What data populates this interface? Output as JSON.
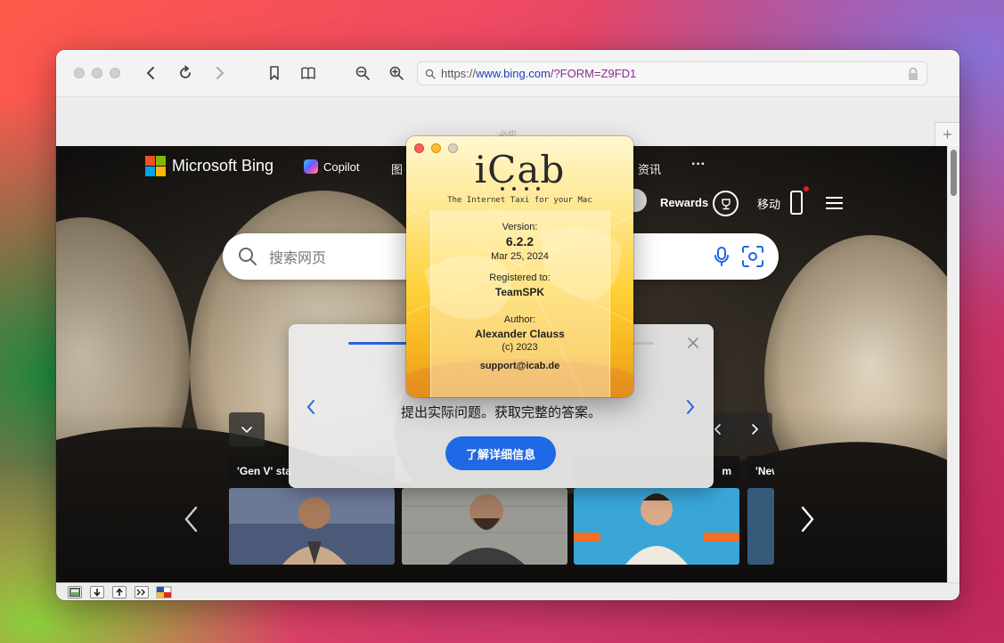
{
  "browser": {
    "url_scheme": "https://",
    "url_host": "www.bing.com",
    "url_path": "/?FORM=Z9FD1",
    "tab_hint": "必应",
    "new_tab_label": "+"
  },
  "bing": {
    "logo_text": "Microsoft Bing",
    "nav": {
      "copilot": "Copilot",
      "images_partial": "图",
      "news": "资讯",
      "more": "···"
    },
    "rewards_label": "Rewards",
    "mobile_label": "移动",
    "search_placeholder": "搜索网页",
    "modal": {
      "message": "提出实际问题。获取完整的答案。",
      "learn_more": "了解详细信息",
      "progress": 0.3
    },
    "news": [
      {
        "title": "'Gen V' sta"
      },
      {
        "title": ""
      },
      {
        "title": "m"
      },
      {
        "title": "'New"
      }
    ]
  },
  "about_panel": {
    "logo": "iCab",
    "tagline": "The Internet Taxi for your Mac",
    "version_label": "Version:",
    "version": "6.2.2",
    "date": "Mar 25, 2024",
    "registered_label": "Registered to:",
    "registered_to": "TeamSPK",
    "author_label": "Author:",
    "author": "Alexander Clauss",
    "copyright": "(c) 2023",
    "email": "support@icab.de"
  },
  "colors": {
    "accent_blue": "#1f68e6",
    "url_host": "#1f3fb8",
    "url_path": "#8a2d8e",
    "traffic_red": "#ff5f57",
    "traffic_yellow": "#febc2e"
  }
}
